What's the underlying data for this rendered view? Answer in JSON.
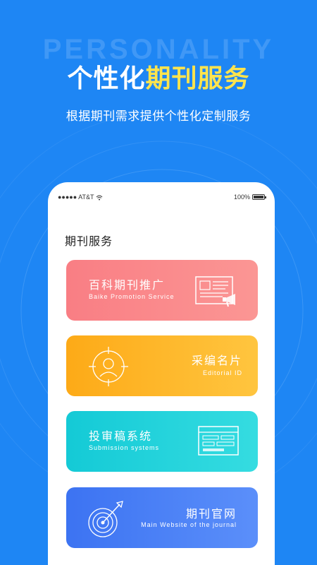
{
  "hero": {
    "watermark": "PERSONALITY",
    "headline_white": "个性化",
    "headline_yellow": "期刊服务",
    "subline": "根据期刊需求提供个性化定制服务"
  },
  "status_bar": {
    "carrier": "●●●●● AT&T",
    "battery": "100%"
  },
  "section_title": "期刊服务",
  "cards": [
    {
      "title": "百科期刊推广",
      "subtitle": "Baike Promotion Service",
      "icon": "newspaper-megaphone-icon"
    },
    {
      "title": "采编名片",
      "subtitle": "Editorial ID",
      "icon": "person-target-icon"
    },
    {
      "title": "投审稿系统",
      "subtitle": "Submission systems",
      "icon": "form-document-icon"
    },
    {
      "title": "期刊官网",
      "subtitle": "Main Website of the journal",
      "icon": "target-arrow-icon"
    }
  ],
  "colors": {
    "background": "#1E86F4",
    "highlight": "#FFE44D",
    "card1": "#F97E84",
    "card2": "#FDAA17",
    "card3": "#14CAD6",
    "card4": "#3C73F2"
  }
}
